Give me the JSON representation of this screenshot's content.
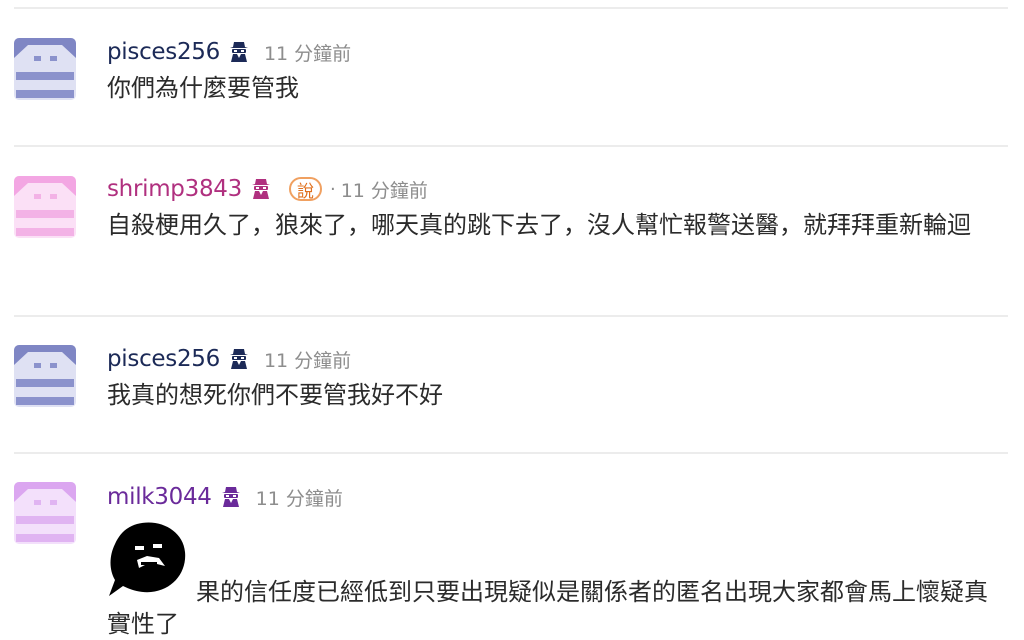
{
  "colors": {
    "navy_user": "#1c2a57",
    "magenta_user": "#b0307f",
    "purple_user": "#6a2a9a",
    "timestamp": "#8d8d8d",
    "text": "#2b2b2b",
    "badge": "#e0701e"
  },
  "comments": [
    {
      "username": "pisces256",
      "user_icon": "spy-icon",
      "time": "11 分鐘前",
      "text": "你們為什麼要管我"
    },
    {
      "username": "shrimp3843",
      "user_icon": "spy-icon",
      "badge": "說",
      "separator": "·",
      "time": "11 分鐘前",
      "text": "自殺梗用久了，狼來了，哪天真的跳下去了，沒人幫忙報警送醫，就拜拜重新輪迴"
    },
    {
      "username": "pisces256",
      "user_icon": "spy-icon",
      "time": "11 分鐘前",
      "text": "我真的想死你們不要管我好不好"
    },
    {
      "username": "milk3044",
      "user_icon": "spy-icon",
      "time": "11 分鐘前",
      "sticker": "black-blob-crying-sticker",
      "text": "果的信任度已經低到只要出現疑似是關係者的匿名出現大家都會馬上懷疑真實性了"
    }
  ]
}
